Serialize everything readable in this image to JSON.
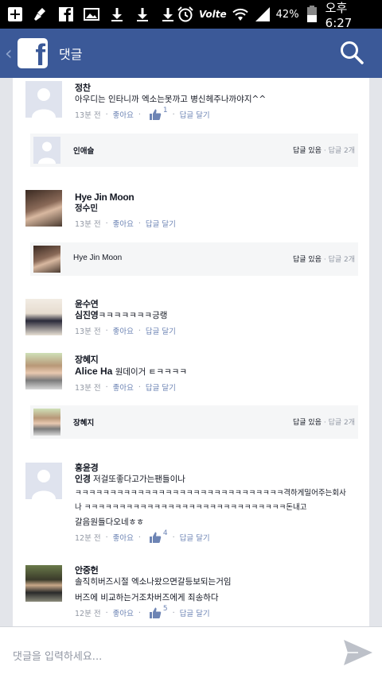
{
  "status_bar": {
    "battery": "42%",
    "time": "오후 6:27",
    "carrier": "Volte"
  },
  "app_bar": {
    "title": "댓글"
  },
  "comments": [
    {
      "name": "정찬",
      "body": "아우디는 인타니까 엑소는못까고 병신헤주나까야지^^",
      "time": "13분 전",
      "like": "좋아요",
      "like_count": "1",
      "reply": "답글 달기"
    },
    {
      "reply_row": true,
      "name": "인애슬",
      "has_replies": "답글 있음",
      "count": "답글 2개"
    },
    {
      "name": "Hye Jin Moon",
      "mention": "정수민",
      "body": "",
      "time": "13분 전",
      "like": "좋아요",
      "reply": "답글 달기"
    },
    {
      "reply_row": true,
      "name": "Hye Jin Moon",
      "has_replies": "답글 있음",
      "count": "답글 2개"
    },
    {
      "name": "윤수연",
      "mention": "심진영",
      "body": "ㅋㅋㅋㅋㅋㅋㅋ긍랭",
      "time": "13분 전",
      "like": "좋아요",
      "reply": "답글 달기"
    },
    {
      "name": "장혜지",
      "mention": "Alice Ha",
      "body": "원데이거 ㅌㅋㅋㅋㅋ",
      "time": "13분 전",
      "like": "좋아요",
      "reply": "답글 달기"
    },
    {
      "reply_row": true,
      "name": "장혜지",
      "has_replies": "답글 있음",
      "count": "답글 2개"
    },
    {
      "name": "홍윤경",
      "mention": "인경",
      "body_line1": "저걸또좋다고가는팬들이나",
      "body_line2": "ㅋㅋㅋㅋㅋㅋㅋㅋㅋㅋㅋㅋㅋㅋㅋㅋㅋㅋㅋㅋㅋㅋㅋㅋㅋㅋㅋㅋㅋㅋ격하게밀어주는회사",
      "body_line3": "나 ㅋㅋㅋㅋㅋㅋㅋㅋㅋㅋㅋㅋㅋㅋㅋㅋㅋㅋㅋㅋㅋㅋㅋㅋㅋㅋㅋㅋㅋ돈내고",
      "body_line4": "갈음원들다오네ㅎㅎ",
      "time": "12분 전",
      "like": "좋아요",
      "like_count": "4",
      "reply": "답글 달기"
    },
    {
      "name": "안중헌",
      "body_line1": "솔직히버즈시절 엑소나왔으면갈등보되는거임",
      "body_line2": "버즈에 비교하는거조차버즈에게 죄송하다",
      "time": "12분 전",
      "like": "좋아요",
      "like_count": "5",
      "reply": "답글 달기"
    }
  ],
  "input": {
    "placeholder": "댓글을 입력하세요..."
  },
  "colors": {
    "brand": "#3b5998",
    "link": "#6d84b4",
    "muted": "#9197a3"
  },
  "icons": [
    "add-icon",
    "broom-icon",
    "facebook-icon",
    "gallery-icon",
    "download-icon",
    "alarm-icon",
    "wifi-icon",
    "signal-icon",
    "battery-icon",
    "search-icon",
    "like-icon",
    "send-icon"
  ]
}
